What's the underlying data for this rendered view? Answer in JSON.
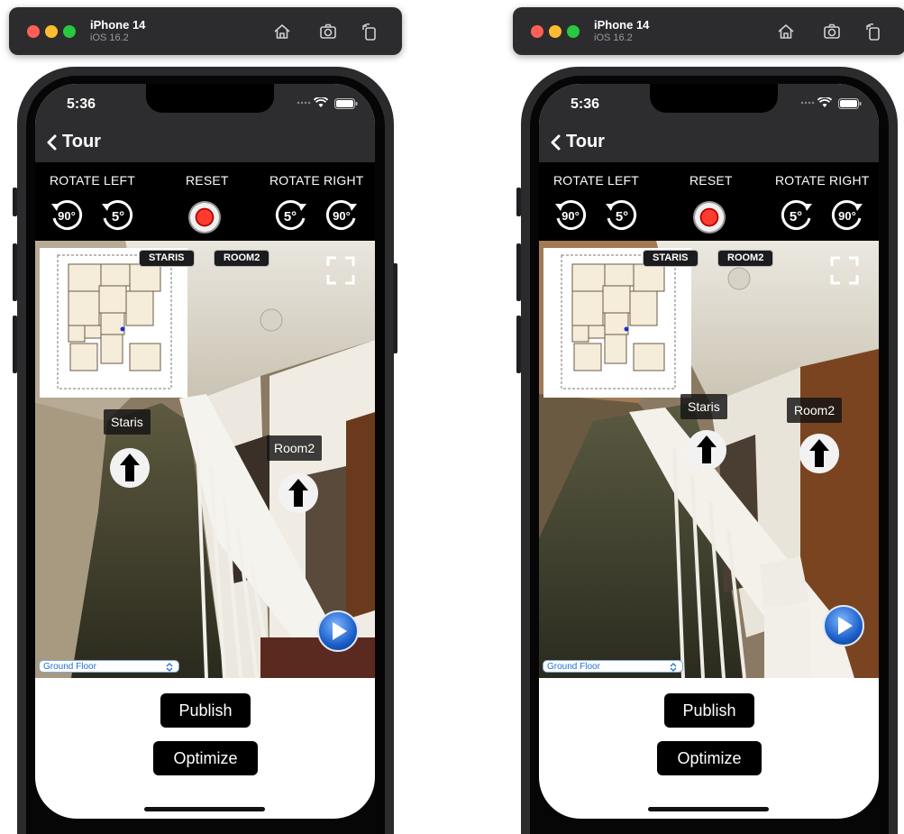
{
  "simulators": [
    {
      "device": "iPhone 14",
      "os": "iOS 16.2",
      "status_time": "5:36",
      "nav_title": "Tour",
      "controls": {
        "rotate_left": "ROTATE LEFT",
        "reset": "RESET",
        "rotate_right": "ROTATE RIGHT",
        "deg90": "90°",
        "deg5": "5°"
      },
      "chips": [
        "STARIS",
        "ROOM2"
      ],
      "hotspots": [
        {
          "label": "Staris"
        },
        {
          "label": "Room2"
        }
      ],
      "floor_select": "Ground Floor",
      "publish": "Publish",
      "optimize": "Optimize"
    },
    {
      "device": "iPhone 14",
      "os": "iOS 16.2",
      "status_time": "5:36",
      "nav_title": "Tour",
      "controls": {
        "rotate_left": "ROTATE LEFT",
        "reset": "RESET",
        "rotate_right": "ROTATE RIGHT",
        "deg90": "90°",
        "deg5": "5°"
      },
      "chips": [
        "STARIS",
        "ROOM2"
      ],
      "hotspots": [
        {
          "label": "Staris"
        },
        {
          "label": "Room2"
        }
      ],
      "floor_select": "Ground Floor",
      "publish": "Publish",
      "optimize": "Optimize"
    }
  ],
  "icons": {
    "home": "home-icon",
    "screenshot": "camera-icon",
    "rotate": "rotate-device-icon",
    "back": "chevron-left-icon",
    "fullscreen": "fullscreen-icon",
    "play": "play-icon",
    "arrow": "arrow-up-icon"
  }
}
